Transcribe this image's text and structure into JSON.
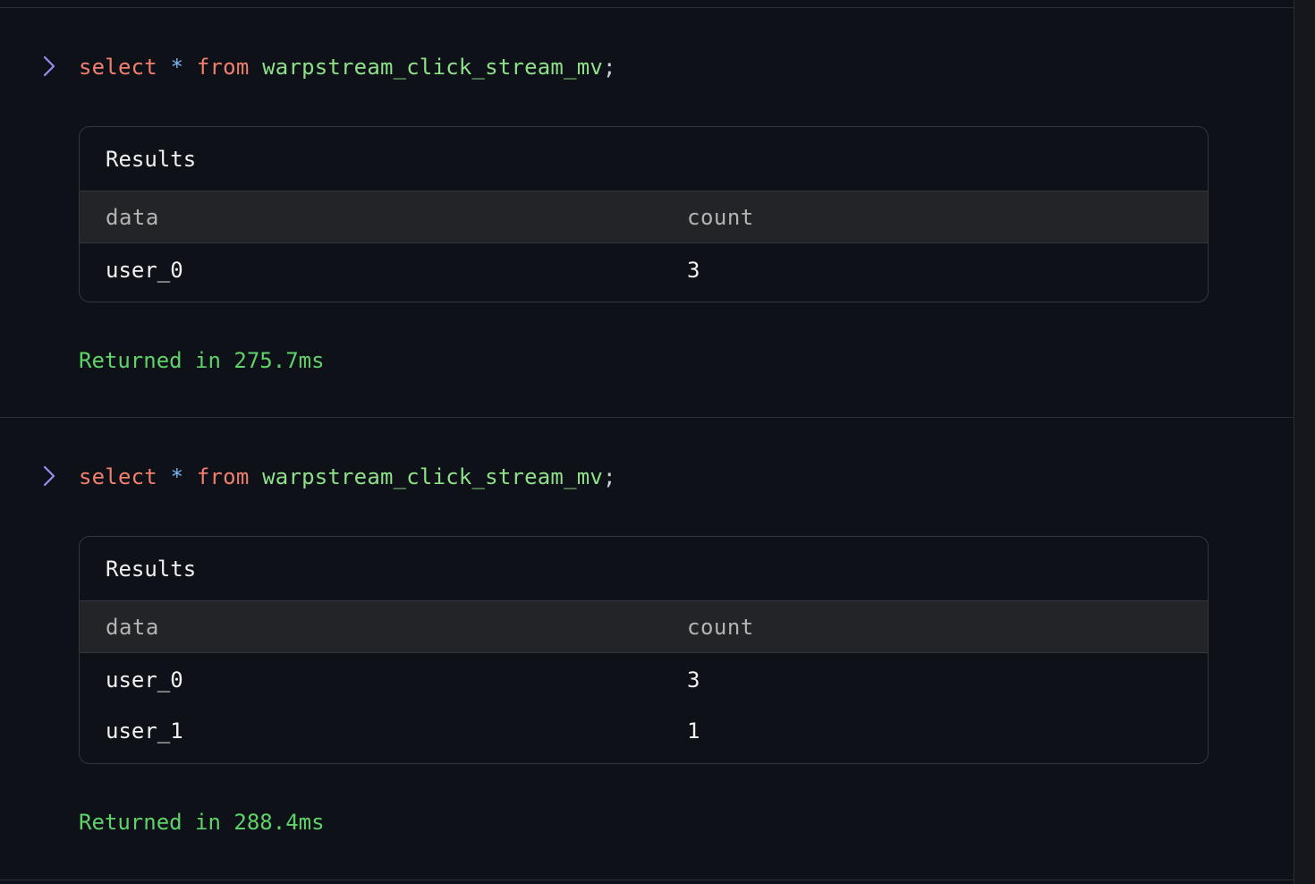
{
  "entries": [
    {
      "query": {
        "select": "select",
        "star": "*",
        "from": "from",
        "table": "warpstream_click_stream_mv",
        "semicolon": ";"
      },
      "results": {
        "title": "Results",
        "columns": [
          "data",
          "count"
        ],
        "rows": [
          [
            "user_0",
            "3"
          ]
        ]
      },
      "status": "Returned in 275.7ms"
    },
    {
      "query": {
        "select": "select",
        "star": "*",
        "from": "from",
        "table": "warpstream_click_stream_mv",
        "semicolon": ";"
      },
      "results": {
        "title": "Results",
        "columns": [
          "data",
          "count"
        ],
        "rows": [
          [
            "user_0",
            "3"
          ],
          [
            "user_1",
            "1"
          ]
        ]
      },
      "status": "Returned in 288.4ms"
    }
  ],
  "icons": {
    "prompt": "chevron-right-icon"
  },
  "colors": {
    "background": "#0e1117",
    "keyword": "#f07f6e",
    "star": "#79b6f2",
    "identifier": "#8ee08a",
    "status": "#5fd26a",
    "prompt": "#9a8cf0"
  }
}
